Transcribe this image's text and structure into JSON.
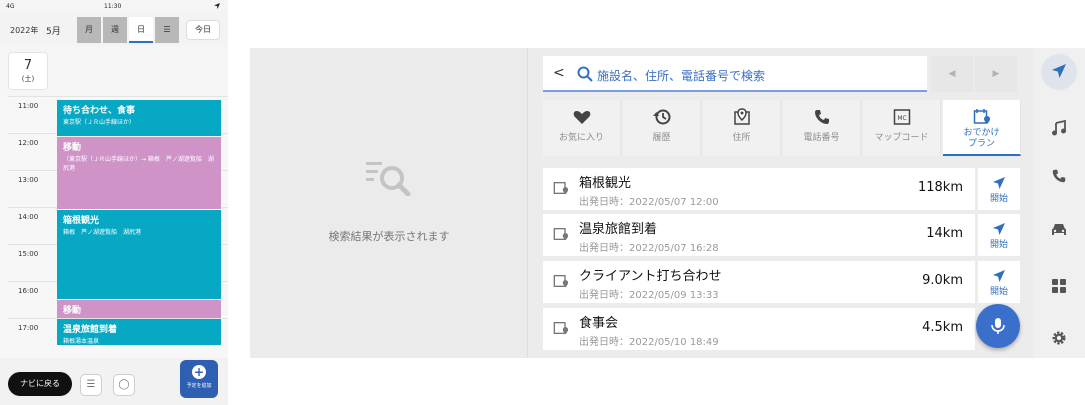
{
  "phone": {
    "status": {
      "left": "4G",
      "time": "11:30",
      "right": "◁"
    },
    "header": {
      "year": "2022年",
      "month": "5月",
      "views": [
        {
          "label": "月",
          "active": false
        },
        {
          "label": "週",
          "active": false
        },
        {
          "label": "日",
          "active": true
        },
        {
          "label": "☰",
          "active": false
        }
      ],
      "today_label": "今日"
    },
    "day": {
      "number": "7",
      "weekday": "(土)"
    },
    "times": [
      "11:00",
      "12:00",
      "13:00",
      "14:00",
      "15:00",
      "16:00",
      "17:00"
    ],
    "events": [
      {
        "title": "待ち合わせ、食事",
        "sub": "東京駅（ＪＲ山手線ほか）",
        "color": "teal"
      },
      {
        "title": "移動",
        "sub": "（東京駅（ＪＲ山手線ほか）→ 箱根　芦ノ湖遊覧船　湖尻港",
        "color": "pink"
      },
      {
        "title": "箱根観光",
        "sub": "箱根　芦ノ湖遊覧船　湖尻港",
        "color": "teal"
      },
      {
        "title": "移動",
        "sub": "",
        "color": "pink"
      },
      {
        "title": "温泉旅館到着",
        "sub": "箱根湯本温泉",
        "color": "teal"
      }
    ],
    "bottom": {
      "navi_back": "ナビに戻る",
      "add_label": "予定を追加"
    }
  },
  "navi": {
    "empty_message": "検索結果が表示されます",
    "search_placeholder": "施設名、住所、電話番号で検索",
    "tabs": [
      {
        "label": "お気に入り",
        "icon": "heart-icon"
      },
      {
        "label": "履歴",
        "icon": "history-icon"
      },
      {
        "label": "住所",
        "icon": "address-pin-icon"
      },
      {
        "label": "電話番号",
        "icon": "phone-icon"
      },
      {
        "label": "マップコード",
        "icon": "mapcode-icon"
      },
      {
        "label": "おでかけ\nプラン",
        "icon": "outing-plan-icon",
        "active": true
      }
    ],
    "results": [
      {
        "name": "箱根観光",
        "date": "出発日時：2022/05/07 12:00",
        "distance": "118km",
        "start": "開始"
      },
      {
        "name": "温泉旅館到着",
        "date": "出発日時：2022/05/07 16:28",
        "distance": "14km",
        "start": "開始"
      },
      {
        "name": "クライアント打ち合わせ",
        "date": "出発日時：2022/05/09 13:33",
        "distance": "9.0km",
        "start": "開始"
      },
      {
        "name": "食事会",
        "date": "出発日時：2022/05/10 18:49",
        "distance": "4.5km",
        "start": "開始"
      }
    ],
    "side_nav": [
      "navigation-arrow-icon",
      "music-note-icon",
      "phone-icon",
      "car-icon",
      "apps-grid-icon",
      "settings-gear-icon"
    ],
    "colors": {
      "accent": "#2f6fbf",
      "mic": "#3a6fcb",
      "teal": "#06a8c4",
      "pink": "#cf93c8"
    }
  }
}
